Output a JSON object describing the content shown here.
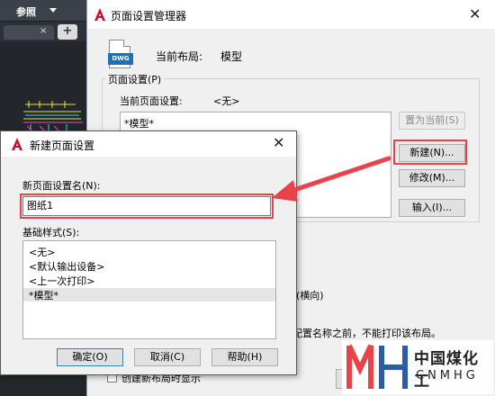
{
  "background_app": {
    "ribbon_tab_label": "参照",
    "doc_tab_close": "×",
    "add_tab": "+"
  },
  "page_setup_manager": {
    "title": "页面设置管理器",
    "close_glyph": "✕",
    "current_layout_label": "当前布局:",
    "current_layout_value": "模型",
    "icon_label": "DWG",
    "page_setup_group_label": "页面设置(P)",
    "current_page_setup_label": "当前页面设置:",
    "current_page_setup_value": "<无>",
    "page_setups": [
      "*模型*"
    ],
    "buttons": {
      "set_current": "置为当前(S)",
      "new": "新建(N)...",
      "modify": "修改(M)...",
      "import": "输入(I)..."
    },
    "details_orientation": "(横向)",
    "details_note": "配置名称之前，不能打印该布局。",
    "create_on_new_layout_label": "创建新布局时显示"
  },
  "new_page_setup": {
    "title": "新建页面设置",
    "close_glyph": "✕",
    "name_label": "新页面设置名(N):",
    "name_value": "图纸1",
    "base_label": "基础样式(S):",
    "base_items": [
      "<无>",
      "<默认输出设备>",
      "<上一次打印>",
      "*模型*"
    ],
    "selected_base_index": 3,
    "buttons": {
      "ok": "确定(O)",
      "cancel": "取消(C)",
      "help": "帮助(H)"
    }
  },
  "watermark": {
    "text_cn": "中国煤化工",
    "text_en": "CNMHG"
  },
  "colors": {
    "highlight": "#e8424b",
    "autocad_red": "#c8102e",
    "dwg_blue": "#1f6fb8",
    "dark_canvas": "#23262b"
  }
}
